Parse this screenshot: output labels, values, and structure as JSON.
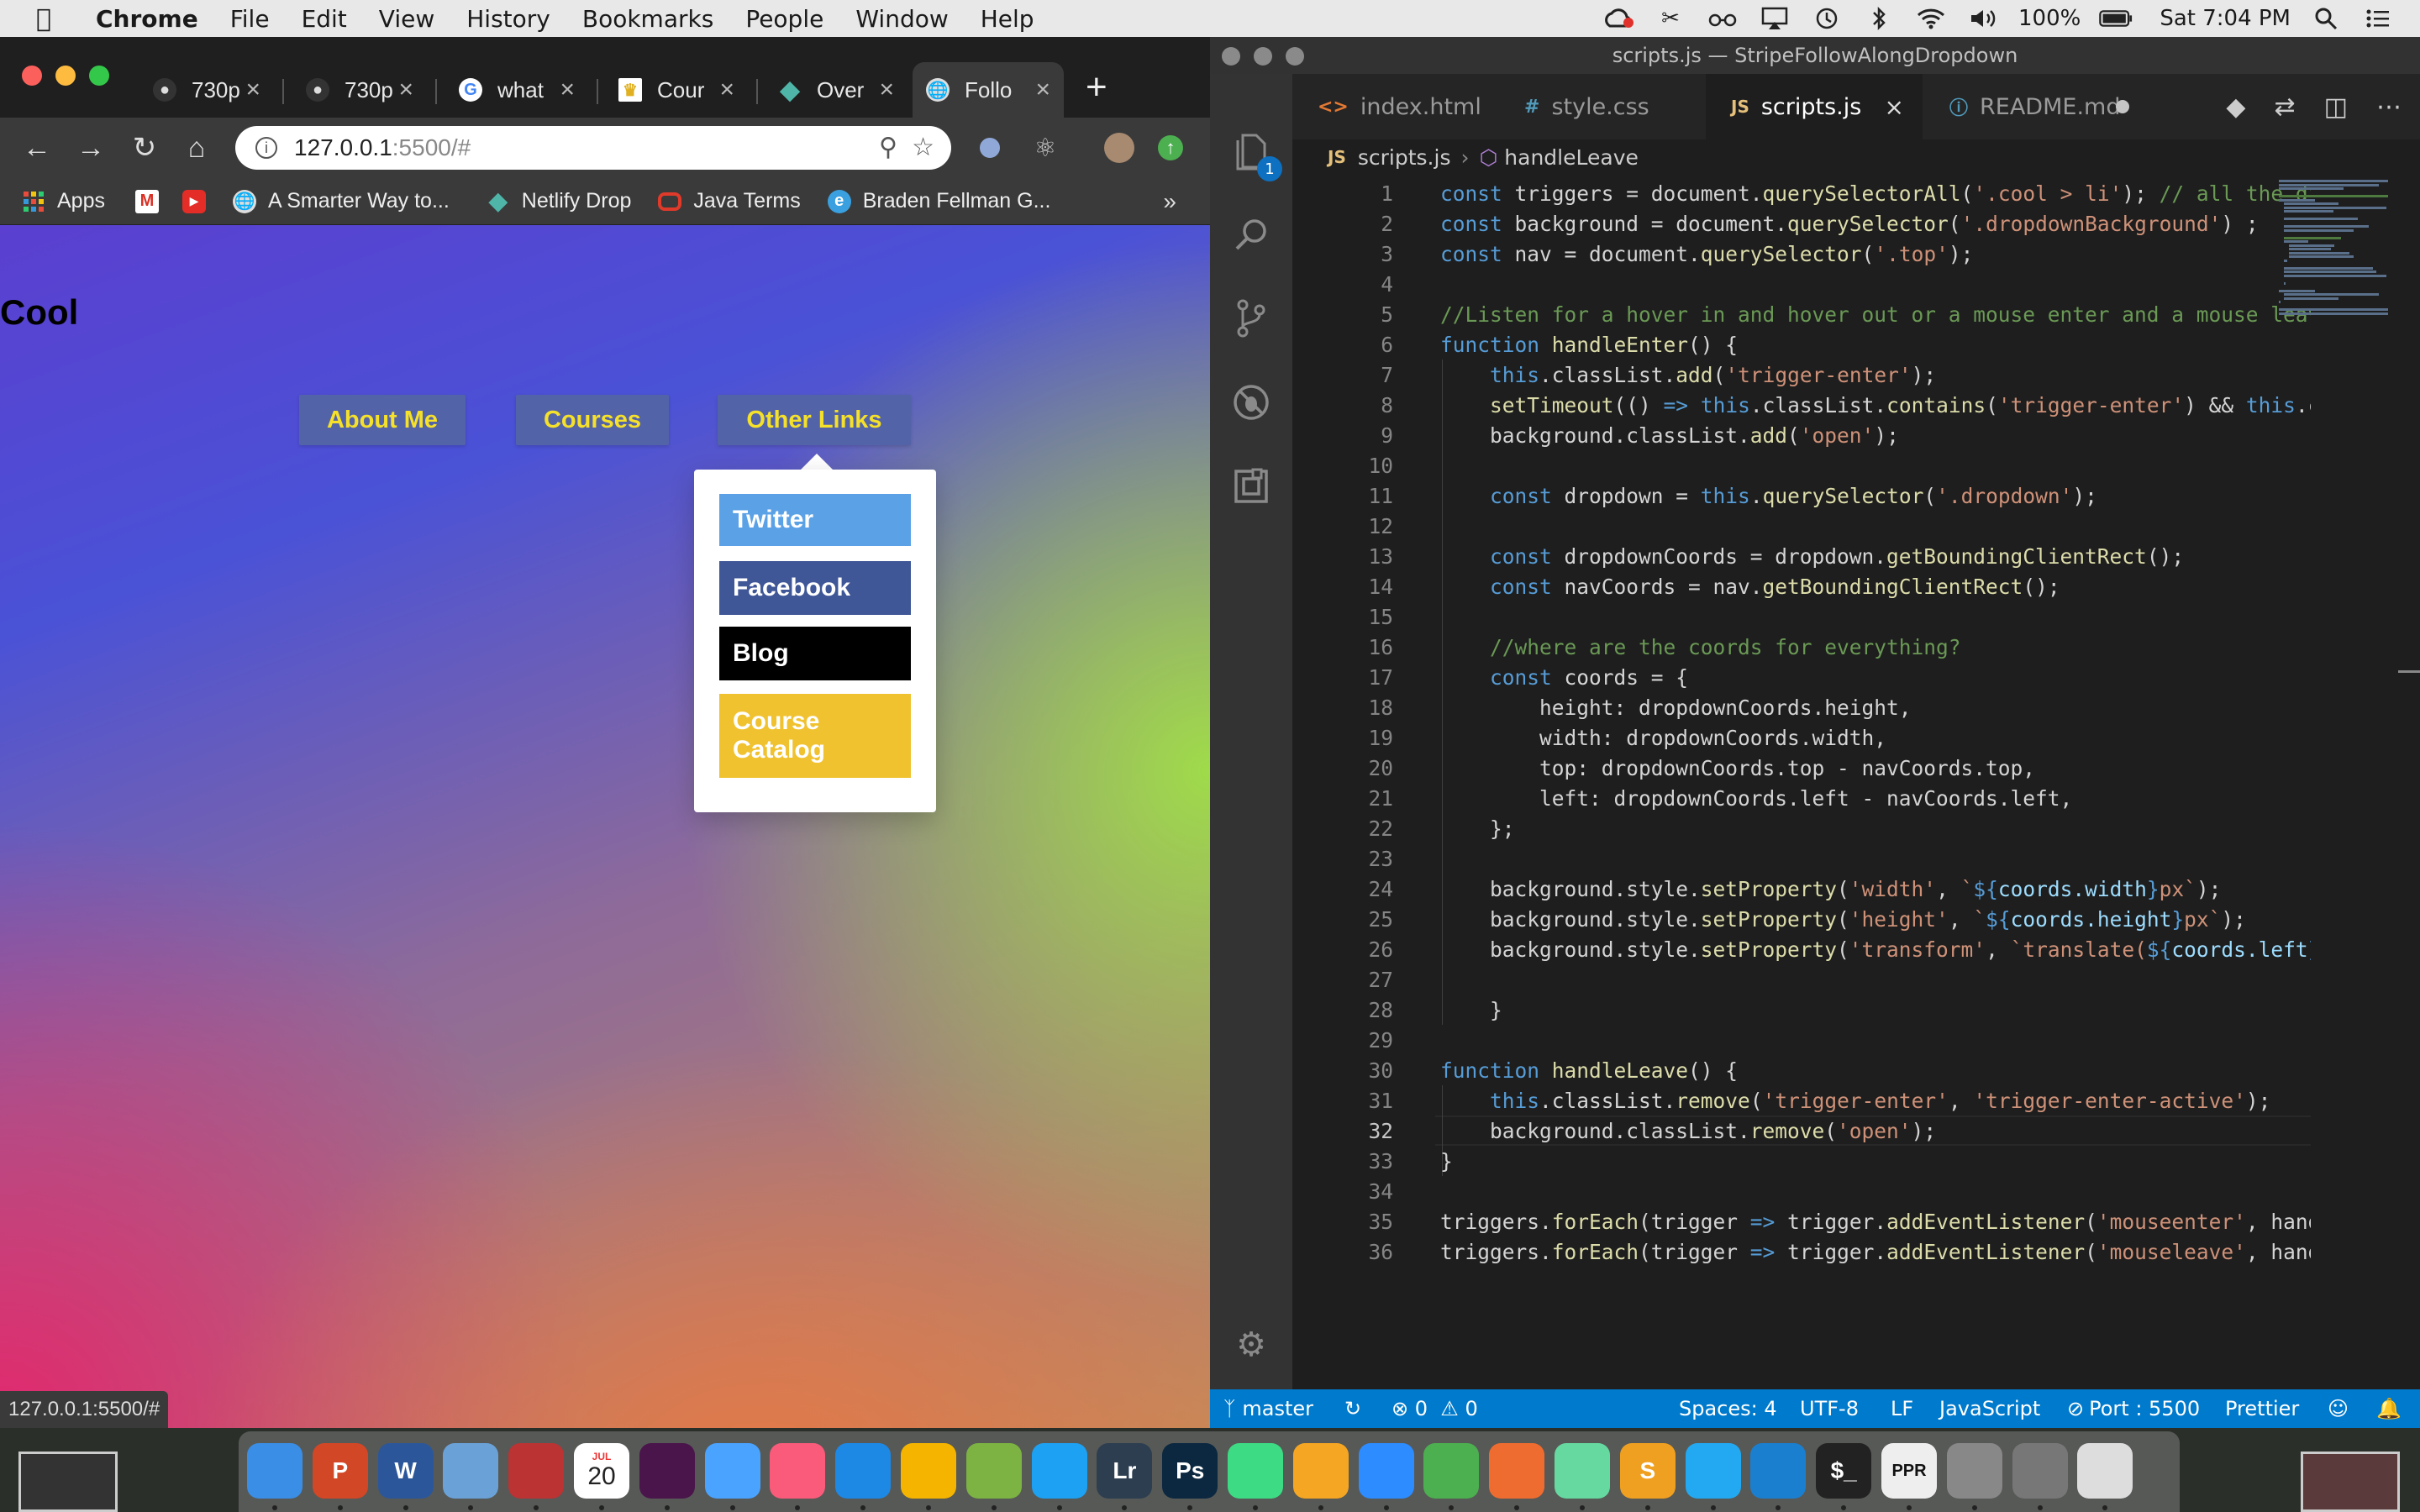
{
  "menubar": {
    "apple": "",
    "app": "Chrome",
    "items": [
      "File",
      "Edit",
      "View",
      "History",
      "Bookmarks",
      "People",
      "Window",
      "Help"
    ],
    "battery": "100%",
    "clock": "Sat 7:04 PM"
  },
  "chrome": {
    "tabs": [
      {
        "label": "730p",
        "favicon": "github-icon"
      },
      {
        "label": "730p",
        "favicon": "github-icon"
      },
      {
        "label": "what",
        "favicon": "google-icon"
      },
      {
        "label": "Cour",
        "favicon": "crown-icon"
      },
      {
        "label": "Over",
        "favicon": "netlify-icon"
      },
      {
        "label": "Follo",
        "favicon": "globe-icon"
      }
    ],
    "new_tab": "+",
    "url_host": "127.0.0.1",
    "url_rest": ":5500/#",
    "bookmarks": [
      {
        "label": "Apps",
        "icon": "apps-grid-icon"
      },
      {
        "label": "",
        "icon": "gmail-icon"
      },
      {
        "label": "",
        "icon": "youtube-icon"
      },
      {
        "label": "A Smarter Way to...",
        "icon": "globe-icon"
      },
      {
        "label": "Netlify Drop",
        "icon": "netlify-icon"
      },
      {
        "label": "Java Terms",
        "icon": "oracle-icon"
      },
      {
        "label": "Braden Fellman G...",
        "icon": "edge-icon"
      }
    ],
    "bookmarks_more": "»",
    "status_url": "127.0.0.1:5500/#"
  },
  "page": {
    "heading": "Cool",
    "nav": [
      "About Me",
      "Courses",
      "Other Links"
    ],
    "dropdown": [
      {
        "label": "Twitter",
        "color": "#5ba1e6"
      },
      {
        "label": "Facebook",
        "color": "#3f5697"
      },
      {
        "label": "Blog",
        "color": "#000000"
      },
      {
        "label": "Course Catalog",
        "color": "#f0c230"
      }
    ]
  },
  "vscode": {
    "title": "scripts.js — StripeFollowAlongDropdown",
    "tabs": [
      {
        "icon": "<>",
        "label": "index.html"
      },
      {
        "icon": "#",
        "label": "style.css"
      },
      {
        "icon": "JS",
        "label": "scripts.js"
      },
      {
        "icon": "ⓘ",
        "label": "README.md"
      }
    ],
    "breadcrumb_file": "scripts.js",
    "breadcrumb_symbol": "handleLeave",
    "explorer_badge": "1",
    "code": [
      "const triggers = document.querySelectorAll('.cool > li'); // all the dir",
      "const background = document.querySelector('.dropdownBackground') ;",
      "const nav = document.querySelector('.top');",
      "",
      "//Listen for a hover in and hover out or a mouse enter and a mouse leave",
      "function handleEnter() {",
      "    this.classList.add('trigger-enter');",
      "    setTimeout(() => this.classList.contains('trigger-enter') && this.cl",
      "    background.classList.add('open');",
      "",
      "    const dropdown = this.querySelector('.dropdown');",
      "",
      "    const dropdownCoords = dropdown.getBoundingClientRect();",
      "    const navCoords = nav.getBoundingClientRect();",
      "",
      "    //where are the coords for everything?",
      "    const coords = {",
      "        height: dropdownCoords.height,",
      "        width: dropdownCoords.width,",
      "        top: dropdownCoords.top - navCoords.top,",
      "        left: dropdownCoords.left - navCoords.left,",
      "    };",
      "",
      "    background.style.setProperty('width', `${coords.width}px`);",
      "    background.style.setProperty('height', `${coords.height}px`);",
      "    background.style.setProperty('transform', `translate(${coords.left}p",
      "",
      "    }",
      "",
      "function handleLeave() {",
      "    this.classList.remove('trigger-enter', 'trigger-enter-active');",
      "    background.classList.remove('open');",
      "}",
      "",
      "triggers.forEach(trigger => trigger.addEventListener('mouseenter', handl",
      "triggers.forEach(trigger => trigger.addEventListener('mouseleave', handl"
    ],
    "current_line": 32,
    "status": {
      "branch": "master",
      "errors": "0",
      "warnings": "0",
      "spaces": "Spaces: 4",
      "encoding": "UTF-8",
      "eol": "LF",
      "language": "JavaScript",
      "port": "Port : 5500",
      "formatter": "Prettier"
    }
  },
  "dock": {
    "thumbnail_left": "",
    "apps": [
      "Finder",
      "PowerPoint",
      "Word",
      "Preview",
      "Photo Booth",
      "Calendar",
      "Slack",
      "Messages",
      "iTunes",
      "Safari",
      "Chrome",
      "Maps",
      "Twitter",
      "Lightroom",
      "Photoshop",
      "Android Studio",
      "Photos",
      "Zoom",
      "MongoDB Compass",
      "Postman",
      "Atom",
      "Sublime Text",
      "VS Code",
      "Xcode",
      "Terminal",
      "PPR pix",
      "Launchpad",
      "System Preferences",
      "Trash"
    ],
    "calendar_month": "JUL",
    "calendar_day": "20"
  }
}
